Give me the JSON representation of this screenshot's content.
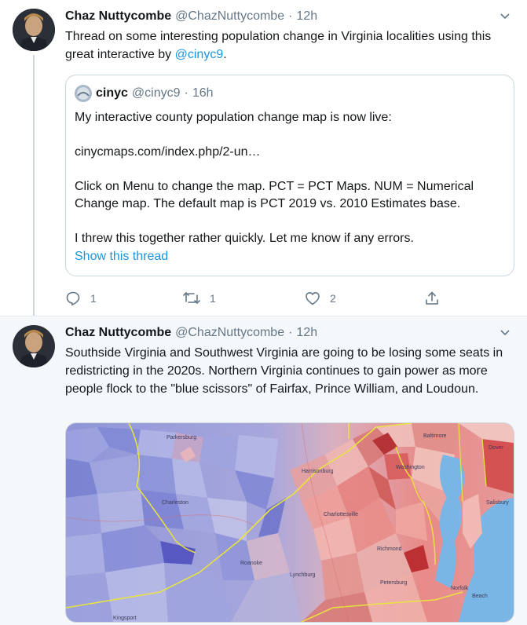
{
  "tweets": [
    {
      "author": {
        "name": "Chaz Nuttycombe",
        "handle": "@ChazNuttycombe"
      },
      "time": "12h",
      "text_prefix": "Thread on some interesting population change in Virginia localities using this great interactive by ",
      "text_mention": "@cinyc9",
      "text_suffix": ".",
      "quote": {
        "author": {
          "name": "cinyc",
          "handle": "@cinyc9"
        },
        "time": "16h",
        "paragraphs": [
          "My interactive county population change map is now live:",
          "cinycmaps.com/index.php/2-un…",
          "Click on Menu to change the map. PCT = PCT Maps. NUM = Numerical Change map. The default map is PCT 2019 vs. 2010 Estimates base.",
          "I threw this together rather quickly. Let me know if any errors."
        ],
        "show_thread": "Show this thread"
      },
      "actions": {
        "replies": "1",
        "retweets": "1",
        "likes": "2"
      }
    },
    {
      "author": {
        "name": "Chaz Nuttycombe",
        "handle": "@ChazNuttycombe"
      },
      "time": "12h",
      "text": "Southside Virginia and Southwest Virginia are going to be losing some seats in redistricting in the 2020s. Northern Virginia continues to gain power as more people flock to the \"blue scissors\" of Fairfax, Prince William, and Loudoun.",
      "map_labels": {
        "place_1": "Parkersburg",
        "place_2": "Charleston",
        "place_3": "Harrisonburg",
        "place_4": "Washington",
        "place_5": "Lynchburg",
        "place_6": "Richmond",
        "place_7": "Salisbury",
        "place_8": "Dover",
        "place_9": "Baltimore",
        "place_10": "Norfolk",
        "place_11": "Beach",
        "place_12": "Kingsport",
        "place_13": "Charlottesville",
        "place_14": "Petersburg",
        "place_15": "Roanoke"
      }
    }
  ],
  "colors": {
    "link": "#1b95e0",
    "secondary_text": "#657786",
    "border": "#ccd6dd"
  },
  "icons": [
    "reply-icon",
    "retweet-icon",
    "like-icon",
    "share-icon",
    "caret-down-icon"
  ]
}
